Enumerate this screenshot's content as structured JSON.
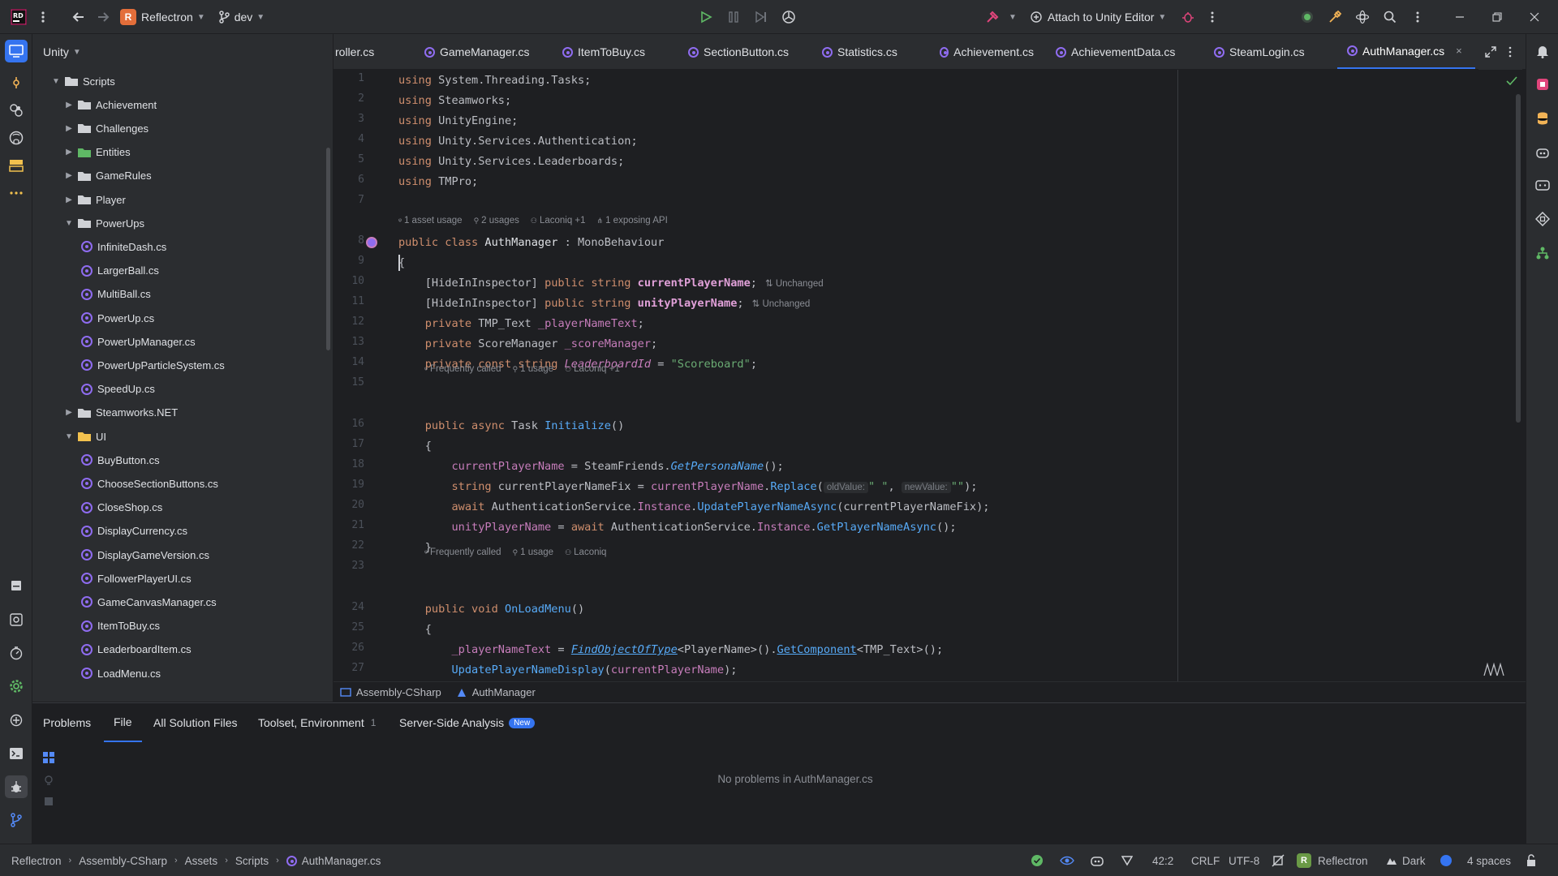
{
  "titlebar": {
    "project_badge": "R",
    "project_name": "Reflectron",
    "branch": "dev",
    "run_config": "Attach to Unity Editor"
  },
  "project_panel": {
    "title": "Unity",
    "tree": [
      {
        "label": "Scripts",
        "depth": 0,
        "kind": "folder",
        "open": true
      },
      {
        "label": "Achievement",
        "depth": 1,
        "kind": "folder",
        "open": false
      },
      {
        "label": "Challenges",
        "depth": 1,
        "kind": "folder",
        "open": false
      },
      {
        "label": "Entities",
        "depth": 1,
        "kind": "folder-green",
        "open": false
      },
      {
        "label": "GameRules",
        "depth": 1,
        "kind": "folder",
        "open": false
      },
      {
        "label": "Player",
        "depth": 1,
        "kind": "folder",
        "open": false
      },
      {
        "label": "PowerUps",
        "depth": 1,
        "kind": "folder",
        "open": true
      },
      {
        "label": "InfiniteDash.cs",
        "depth": 2,
        "kind": "cs"
      },
      {
        "label": "LargerBall.cs",
        "depth": 2,
        "kind": "cs"
      },
      {
        "label": "MultiBall.cs",
        "depth": 2,
        "kind": "cs"
      },
      {
        "label": "PowerUp.cs",
        "depth": 2,
        "kind": "cs"
      },
      {
        "label": "PowerUpManager.cs",
        "depth": 2,
        "kind": "cs"
      },
      {
        "label": "PowerUpParticleSystem.cs",
        "depth": 2,
        "kind": "cs"
      },
      {
        "label": "SpeedUp.cs",
        "depth": 2,
        "kind": "cs"
      },
      {
        "label": "Steamworks.NET",
        "depth": 1,
        "kind": "folder",
        "open": false
      },
      {
        "label": "UI",
        "depth": 1,
        "kind": "folder-yellow",
        "open": true
      },
      {
        "label": "BuyButton.cs",
        "depth": 2,
        "kind": "cs"
      },
      {
        "label": "ChooseSectionButtons.cs",
        "depth": 2,
        "kind": "cs"
      },
      {
        "label": "CloseShop.cs",
        "depth": 2,
        "kind": "cs"
      },
      {
        "label": "DisplayCurrency.cs",
        "depth": 2,
        "kind": "cs"
      },
      {
        "label": "DisplayGameVersion.cs",
        "depth": 2,
        "kind": "cs"
      },
      {
        "label": "FollowerPlayerUI.cs",
        "depth": 2,
        "kind": "cs"
      },
      {
        "label": "GameCanvasManager.cs",
        "depth": 2,
        "kind": "cs"
      },
      {
        "label": "ItemToBuy.cs",
        "depth": 2,
        "kind": "cs"
      },
      {
        "label": "LeaderboardItem.cs",
        "depth": 2,
        "kind": "cs"
      },
      {
        "label": "LoadMenu.cs",
        "depth": 2,
        "kind": "cs"
      }
    ]
  },
  "tabs": [
    {
      "label": "roller.cs",
      "active": false
    },
    {
      "label": "GameManager.cs",
      "active": false
    },
    {
      "label": "ItemToBuy.cs",
      "active": false
    },
    {
      "label": "SectionButton.cs",
      "active": false
    },
    {
      "label": "Statistics.cs",
      "active": false
    },
    {
      "label": "Achievement.cs",
      "active": false
    },
    {
      "label": "AchievementData.cs",
      "active": false
    },
    {
      "label": "SteamLogin.cs",
      "active": false
    },
    {
      "label": "AuthManager.cs",
      "active": true
    }
  ],
  "code": {
    "line_numbers": [
      "1",
      "2",
      "3",
      "4",
      "5",
      "6",
      "7",
      "8",
      "9",
      "10",
      "11",
      "12",
      "13",
      "14",
      "15",
      "16",
      "17",
      "18",
      "19",
      "20",
      "21",
      "22",
      "23",
      "24",
      "25",
      "26",
      "27"
    ],
    "hints": {
      "class": [
        "1 asset usage",
        "2 usages",
        "Laconiq +1",
        "1 exposing API"
      ],
      "initialize": [
        "Frequently called",
        "1 usage",
        "Laconiq +1"
      ],
      "onloadmenu": [
        "Frequently called",
        "1 usage",
        "Laconiq"
      ]
    },
    "unchanged": "Unchanged",
    "param_old": "oldValue:",
    "param_new": "newValue:"
  },
  "editor_breadcrumb": {
    "assembly": "Assembly-CSharp",
    "class": "AuthManager"
  },
  "problems": {
    "tabs": [
      "Problems",
      "File",
      "All Solution Files",
      "Toolset, Environment",
      "Server-Side Analysis"
    ],
    "toolset_count": "1",
    "new_badge": "New",
    "message": "No problems in AuthManager.cs"
  },
  "statusbar": {
    "path": [
      "Reflectron",
      "Assembly-CSharp",
      "Assets",
      "Scripts",
      "AuthManager.cs"
    ],
    "position": "42:2",
    "line_ending": "CRLF",
    "encoding": "UTF-8",
    "solution_badge": "R",
    "solution": "Reflectron",
    "theme": "Dark",
    "indent": "4 spaces"
  },
  "colors": {
    "accent": "#3574f0",
    "cs_icon": "#8f6cf0",
    "keyword": "#cf8e6d",
    "method": "#57aaf7",
    "field": "#c77dbb",
    "string": "#6aab73"
  }
}
